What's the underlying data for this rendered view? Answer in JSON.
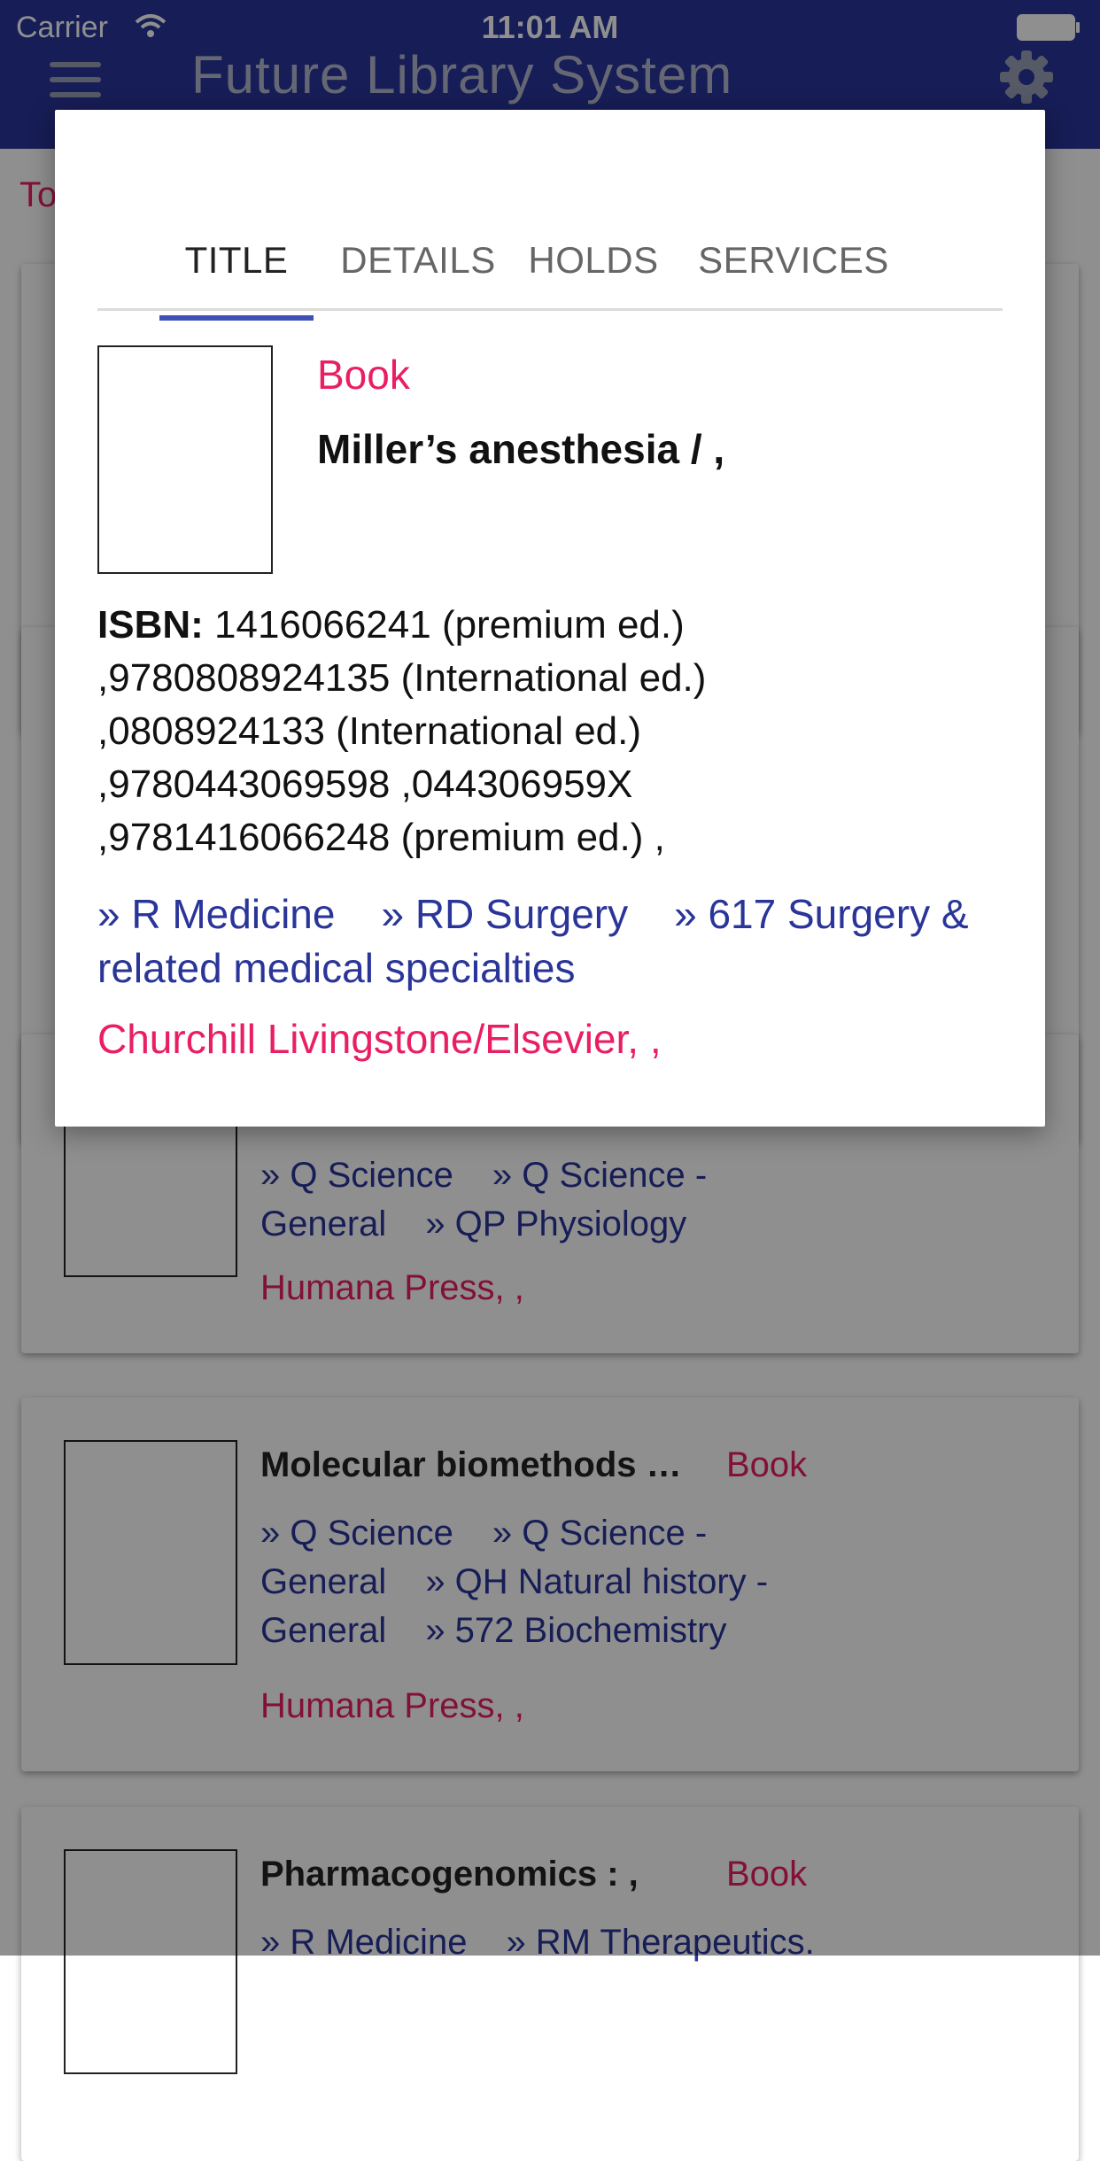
{
  "status_bar": {
    "carrier": "Carrier",
    "time": "11:01 AM"
  },
  "header": {
    "title": "Future Library System"
  },
  "background": {
    "today_link": "To",
    "cards": [
      {
        "title": "",
        "type": "",
        "subjects": [
          "» Q Science",
          "» Q Science - General",
          "» QP Physiology"
        ],
        "publisher": "Humana Press, ,"
      },
      {
        "title": "Molecular biomethods …",
        "type": "Book",
        "subjects": [
          "» Q Science",
          "» Q Science - General",
          "» QH Natural history - General",
          "» 572 Biochemistry"
        ],
        "publisher": "Humana Press, ,"
      },
      {
        "title": "Pharmacogenomics : ,",
        "type": "Book",
        "subjects": [
          "» R Medicine",
          "» RM Therapeutics."
        ],
        "publisher": ""
      }
    ]
  },
  "modal": {
    "tabs": [
      {
        "label": "TITLE",
        "active": true
      },
      {
        "label": "DETAILS",
        "active": false
      },
      {
        "label": "HOLDS",
        "active": false
      },
      {
        "label": "SERVICES",
        "active": false
      }
    ],
    "type": "Book",
    "title": "Miller’s anesthesia / ,",
    "isbn_label": "ISBN:",
    "isbn_lines": [
      " 1416066241 (premium ed.)",
      ",9780808924135 (International ed.)",
      ",0808924133 (International ed.)",
      ",9780443069598 ,044306959X",
      ",9781416066248 (premium ed.) ,"
    ],
    "subjects": [
      "» R Medicine",
      "» RD Surgery",
      "» 617 Surgery & related medical specialties"
    ],
    "publisher": "Churchill Livingstone/Elsevier, ,"
  }
}
